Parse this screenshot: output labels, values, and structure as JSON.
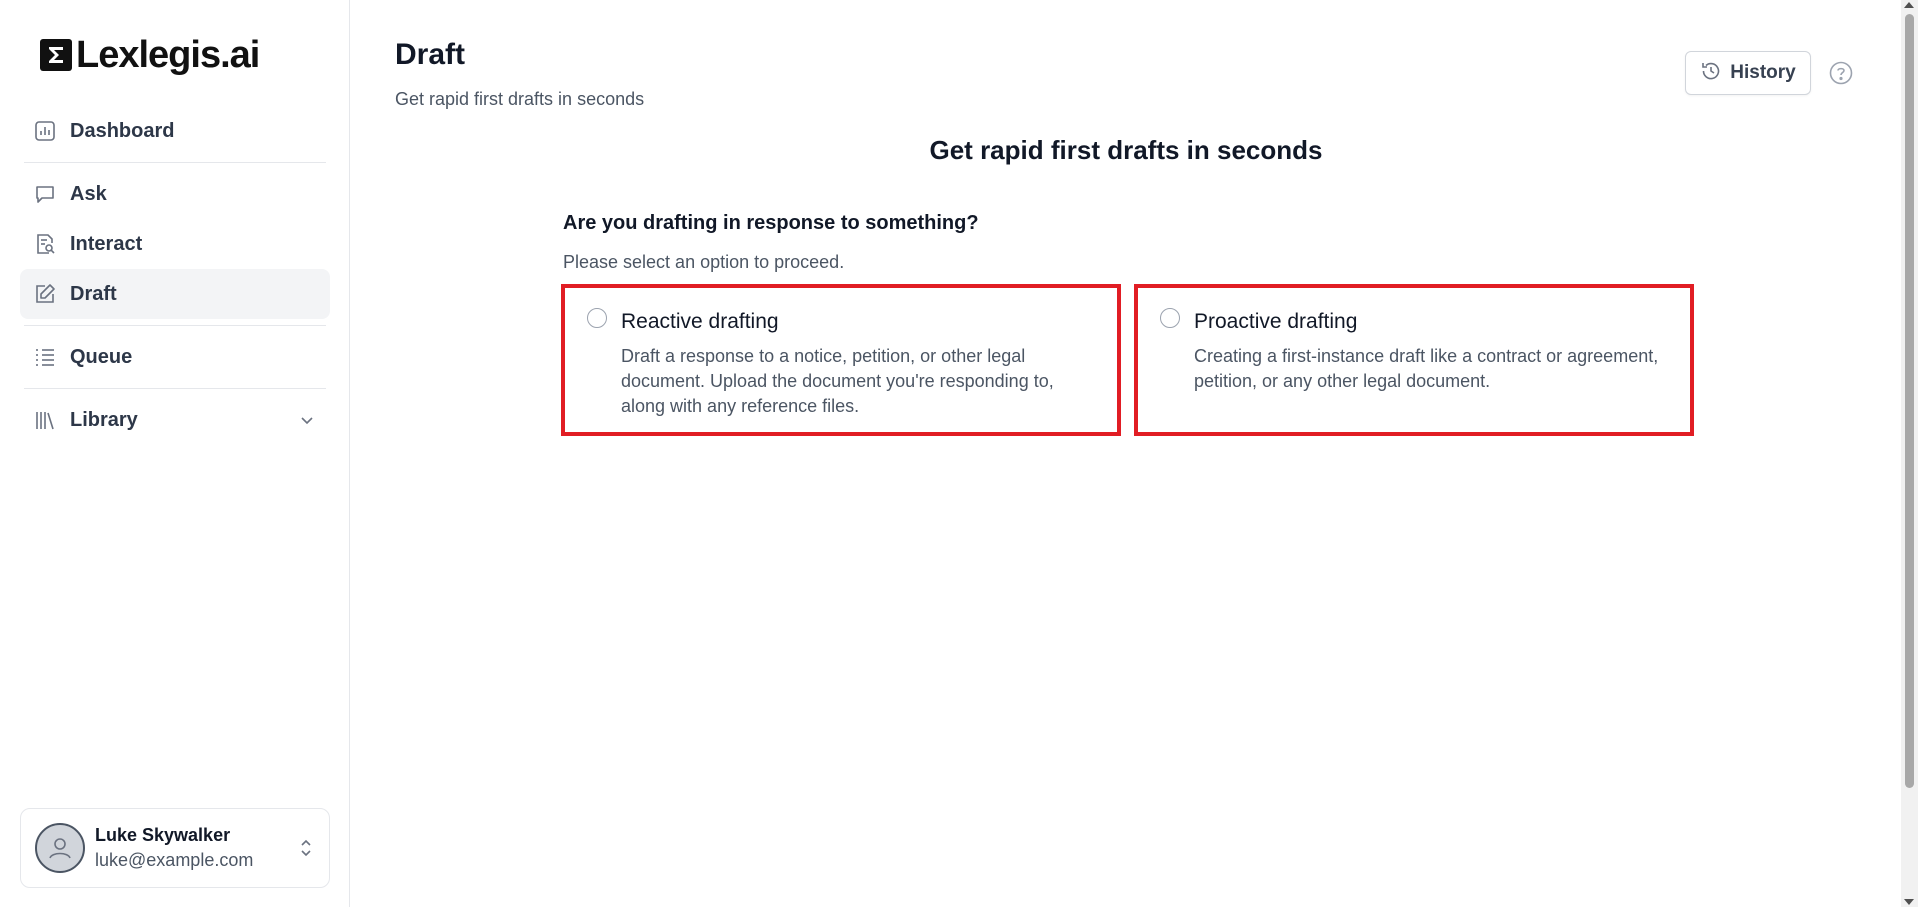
{
  "brand": {
    "name": "Lexlegis.ai"
  },
  "sidebar": {
    "items": [
      {
        "label": "Dashboard",
        "icon": "chart-icon"
      },
      {
        "label": "Ask",
        "icon": "chat-bubble-icon"
      },
      {
        "label": "Interact",
        "icon": "document-search-icon"
      },
      {
        "label": "Draft",
        "icon": "edit-icon",
        "active": true
      },
      {
        "label": "Queue",
        "icon": "list-icon"
      },
      {
        "label": "Library",
        "icon": "library-icon",
        "expandable": true
      }
    ]
  },
  "user": {
    "name": "Luke Skywalker",
    "email": "luke@example.com"
  },
  "header": {
    "title": "Draft",
    "subtitle": "Get rapid first drafts in seconds",
    "history_label": "History"
  },
  "main": {
    "heading": "Get rapid first drafts in seconds",
    "question": "Are you drafting in response to something?",
    "instruction": "Please select an option to proceed.",
    "options": [
      {
        "title": "Reactive drafting",
        "description": "Draft a response to a notice, petition, or other legal document. Upload the document you're responding to, along with any reference files."
      },
      {
        "title": "Proactive drafting",
        "description": "Creating a first-instance draft like a contract or agreement, petition, or any other legal document."
      }
    ]
  },
  "colors": {
    "highlight": "#e11d24",
    "text": "#111827",
    "muted": "#4b5563"
  }
}
